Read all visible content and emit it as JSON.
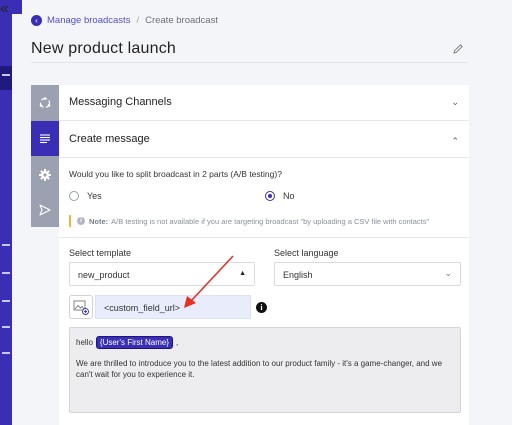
{
  "nav": {
    "collapse_icon": "chevron-double-left-icon"
  },
  "breadcrumb": {
    "parent": "Manage broadcasts",
    "separator": "/",
    "current": "Create broadcast"
  },
  "page": {
    "title": "New product launch"
  },
  "accordion": {
    "messaging_channels": "Messaging Channels",
    "create_message": "Create message"
  },
  "ab_test": {
    "question": "Would you like to split broadcast in 2 parts (A/B testing)?",
    "options": [
      "Yes",
      "No"
    ],
    "selected": "No",
    "note_label": "Note:",
    "note_text": "A/B testing is not available if you are targeting broadcast \"by uploading a CSV file with contacts\""
  },
  "template": {
    "label": "Select template",
    "value": "new_product"
  },
  "language": {
    "label": "Select language",
    "value": "English"
  },
  "url_field": {
    "value": "<custom_field_url>"
  },
  "message": {
    "greeting": "hello",
    "token": "{User's First Name}",
    "punct": ",",
    "body": "We are thrilled to introduce you to the latest addition to our product family - it's a game-changer, and we can't wait for you to experience it."
  },
  "colors": {
    "brand": "#3a2fb4",
    "annotation_arrow": "#e53024"
  }
}
